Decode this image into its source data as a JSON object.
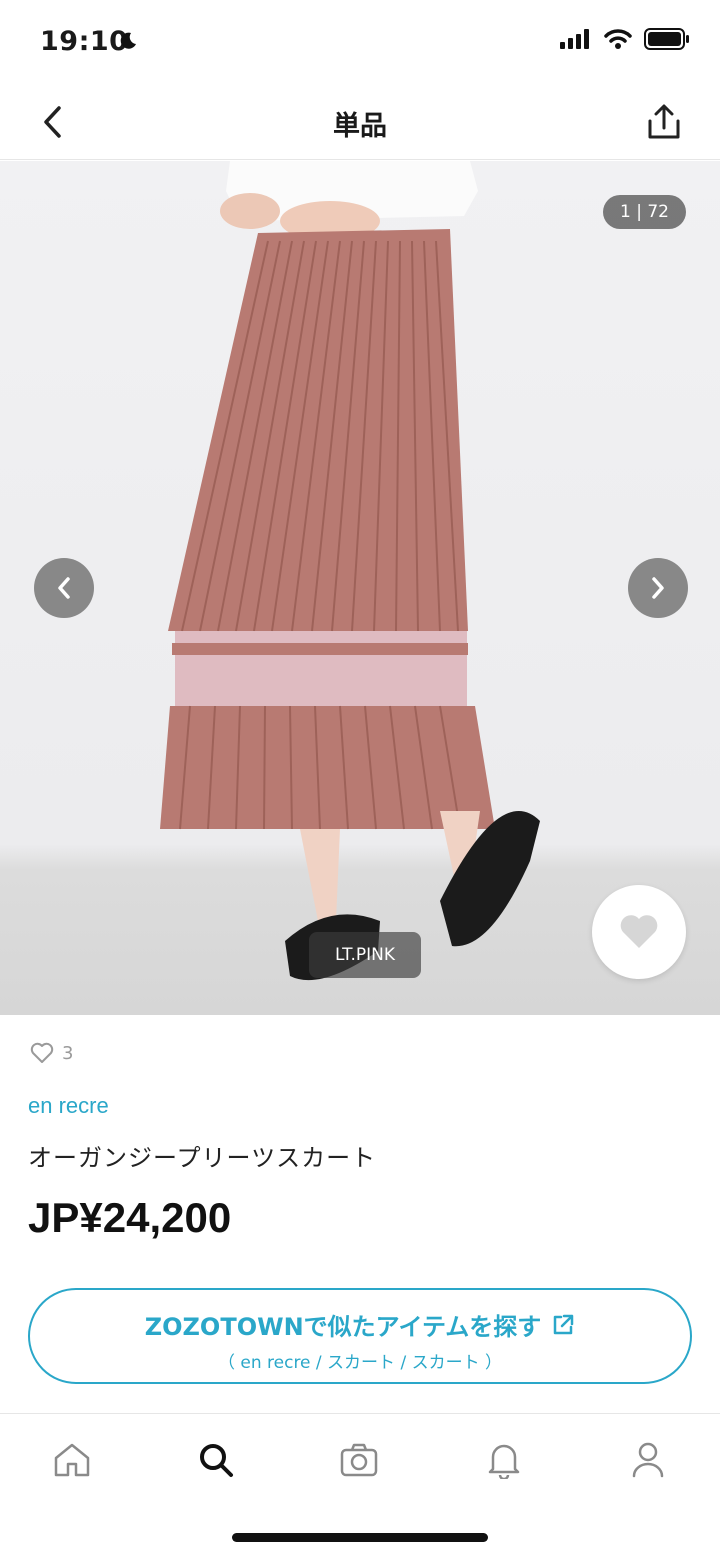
{
  "status_bar": {
    "time": "19:10",
    "icons": [
      "moon-icon",
      "signal-icon",
      "wifi-icon",
      "battery-icon"
    ]
  },
  "nav": {
    "title": "単品",
    "back_icon": "chevron-left-icon",
    "share_icon": "share-icon"
  },
  "gallery": {
    "counter": "1 | 72",
    "color_label": "LT.PINK",
    "prev_icon": "chevron-left-icon",
    "next_icon": "chevron-right-icon",
    "favorite_icon": "heart-icon"
  },
  "product": {
    "like_count": "3",
    "brand": "en recre",
    "name": "オーガンジープリーツスカート",
    "price": "JP¥24,200"
  },
  "similar_button": {
    "label": "ZOZOTOWNで似たアイテムを探す",
    "sub": "（ en recre / スカート / スカート ）",
    "icon": "external-link-icon"
  },
  "tab_bar": {
    "items": [
      "home-icon",
      "search-icon",
      "camera-icon",
      "bell-icon",
      "person-icon"
    ],
    "active": "search-icon"
  },
  "colors": {
    "accent": "#2aa7c9",
    "skirt": "#b87a72",
    "text": "#1a1a1a"
  }
}
